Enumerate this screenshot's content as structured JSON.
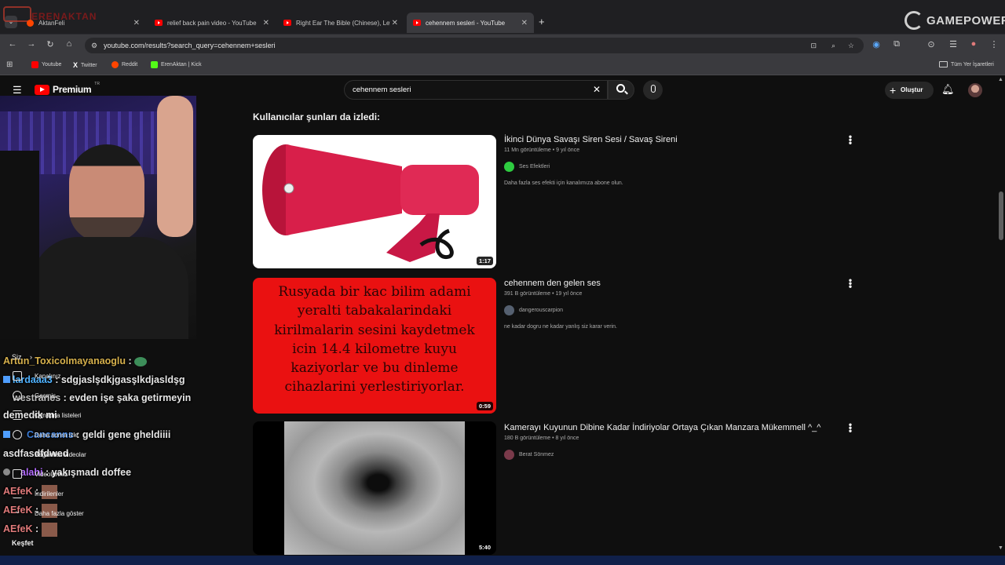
{
  "browser": {
    "tabs": [
      {
        "label": "AktanFeli"
      },
      {
        "label": "relief back pain video - YouTube"
      },
      {
        "label": "Right Ear The Bible (Chinese), Left"
      },
      {
        "label": "cehennem sesleri - YouTube"
      }
    ],
    "url": "youtube.com/results?search_query=cehennem+sesleri",
    "bookmarks": [
      {
        "label": "Youtube",
        "color": "#ff0000"
      },
      {
        "label": "Twitter",
        "color": "#000000"
      },
      {
        "label": "Reddit",
        "color": "#ff4500"
      },
      {
        "label": "ErenAktan | Kick",
        "color": "#53fc18"
      }
    ],
    "all_bookmarks": "Tüm Yer İşaretleri",
    "overlay_logo": "GAMEPOWER",
    "overlay_logo_top": "ERENAKTAN"
  },
  "youtube": {
    "logo": "Premium",
    "country": "TR",
    "search_value": "cehennem sesleri",
    "create_label": "Oluştur"
  },
  "sidebar": {
    "you_label": "Siz",
    "items": [
      {
        "label": "Kanalınız",
        "icon": "person-icon"
      },
      {
        "label": "Geçmiş",
        "icon": "history-icon"
      },
      {
        "label": "Oynatma listeleri",
        "icon": "playlist-icon"
      },
      {
        "label": "Daha sonra izle",
        "icon": "clock-icon"
      },
      {
        "label": "Beğenilen videolar",
        "icon": "thumbs-up-icon"
      },
      {
        "label": "Videolarınız",
        "icon": "video-icon"
      },
      {
        "label": "İndirilenler",
        "icon": "download-icon"
      },
      {
        "label": "Daha fazla göster",
        "icon": "chevron-down-icon"
      }
    ],
    "explore_label": "Keşfet"
  },
  "chat": [
    {
      "user": "Artun_Toxicolmayanaoglu",
      "color": "#d6b04c",
      "msg": " : "
    },
    {
      "user": "lardaaa3",
      "color": "#4fb2ff",
      "msg": " : sdgjaslşdkjgasşlkdjasldşg"
    },
    {
      "user": "westranes",
      "color": "#bbbbbb",
      "msg": " : evden işe şaka getirmeyin demedik mi"
    },
    {
      "user": "Cancanns",
      "color": "#3a7bd5",
      "msg": " : geldi gene gheldiiii"
    },
    {
      "user": "",
      "color": "#e6e6e6",
      "msg": "asdfasdfdwed"
    },
    {
      "user": "alahi",
      "color": "#b36bff",
      "msg": " : yakışmadı doffee"
    },
    {
      "user": "AEfeK",
      "color": "#e07a7a",
      "msg": " : "
    },
    {
      "user": "AEfeK",
      "color": "#e07a7a",
      "msg": " : "
    },
    {
      "user": "AEfeK",
      "color": "#e07a7a",
      "msg": " : "
    }
  ],
  "section_title": "Kullanıcılar şunları da izledi:",
  "videos": [
    {
      "title": "İkinci Dünya Savaşı Siren Sesi / Savaş Sireni",
      "meta": "11 Mn görüntüleme • 9 yıl önce",
      "channel": "Ses Efektleri",
      "channel_color": "#2ecc40",
      "description": "Daha fazla ses efekti için kanalımıza abone olun.",
      "duration": "1:17"
    },
    {
      "title": "cehennem den gelen ses",
      "meta": "391 B görüntüleme • 19 yıl önce",
      "channel": "dangerouscarpion",
      "channel_color": "#556070",
      "description": "ne kadar dogru ne kadar yanlış siz karar verin.",
      "duration": "0:59",
      "thumb_text": "Rusyada bir kac bilim adami yeralti tabakalarindaki kirilmalarin sesini kaydetmek icin 14.4 kilometre kuyu kaziyorlar ve bu dinleme cihazlarini yerlestiriyorlar."
    },
    {
      "title": "Kamerayı Kuyunun Dibine Kadar İndiriyolar Ortaya Çıkan Manzara Mükemmell ^_^",
      "meta": "180 B görüntüleme • 8 yıl önce",
      "channel": "Berat Sönmez",
      "channel_color": "#7a3a4a",
      "duration": "5:40"
    }
  ]
}
